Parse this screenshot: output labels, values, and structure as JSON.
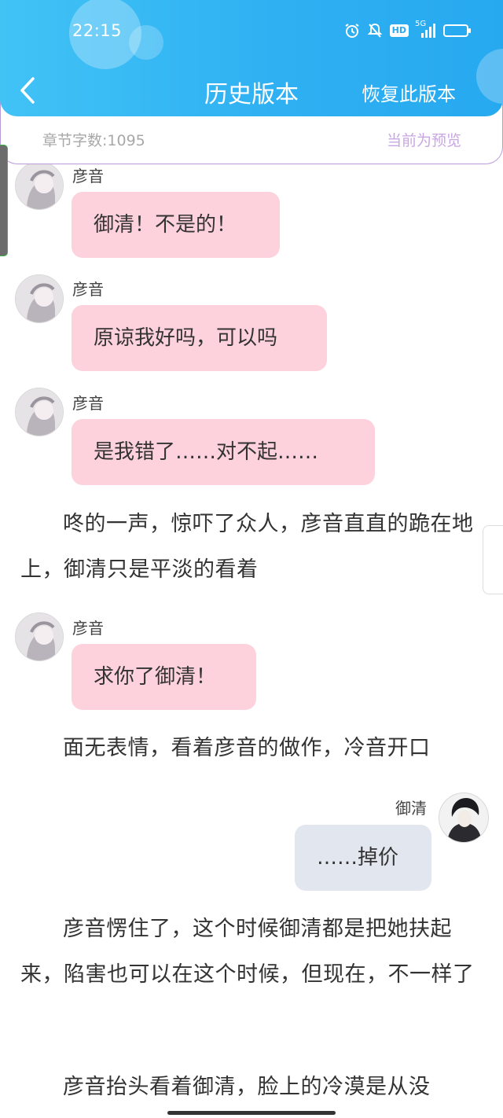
{
  "status": {
    "time": "22:15",
    "hd": "HD",
    "net": "5G"
  },
  "header": {
    "title": "历史版本",
    "restore": "恢复此版本"
  },
  "info": {
    "word_count": "章节字数:1095",
    "preview": "当前为预览"
  },
  "messages": [
    {
      "speaker": "彦音",
      "text": "御清！不是的！"
    },
    {
      "speaker": "彦音",
      "text": "原谅我好吗，可以吗"
    },
    {
      "speaker": "彦音",
      "text": "是我错了……对不起……"
    },
    {
      "speaker": "彦音",
      "text": "求你了御清！"
    },
    {
      "speaker": "御清",
      "text": "……掉价"
    }
  ],
  "paragraphs": [
    "咚的一声，惊吓了众人，彦音直直的跪在地上，御清只是平淡的看着",
    "面无表情，看着彦音的做作，冷音开口",
    "彦音愣住了，这个时候御清都是把她扶起来，陷害也可以在这个时候，但现在，不一样了",
    "彦音抬头看着御清，脸上的冷漠是从没"
  ],
  "colors": {
    "header": "#2fb0f2",
    "left_bubble": "#fdd2dd",
    "right_bubble": "#e2e6ef",
    "preview": "#c9a6e3"
  },
  "icons": [
    "back-chevron-icon",
    "alarm-icon",
    "mute-icon",
    "signal-icon",
    "battery-icon"
  ]
}
